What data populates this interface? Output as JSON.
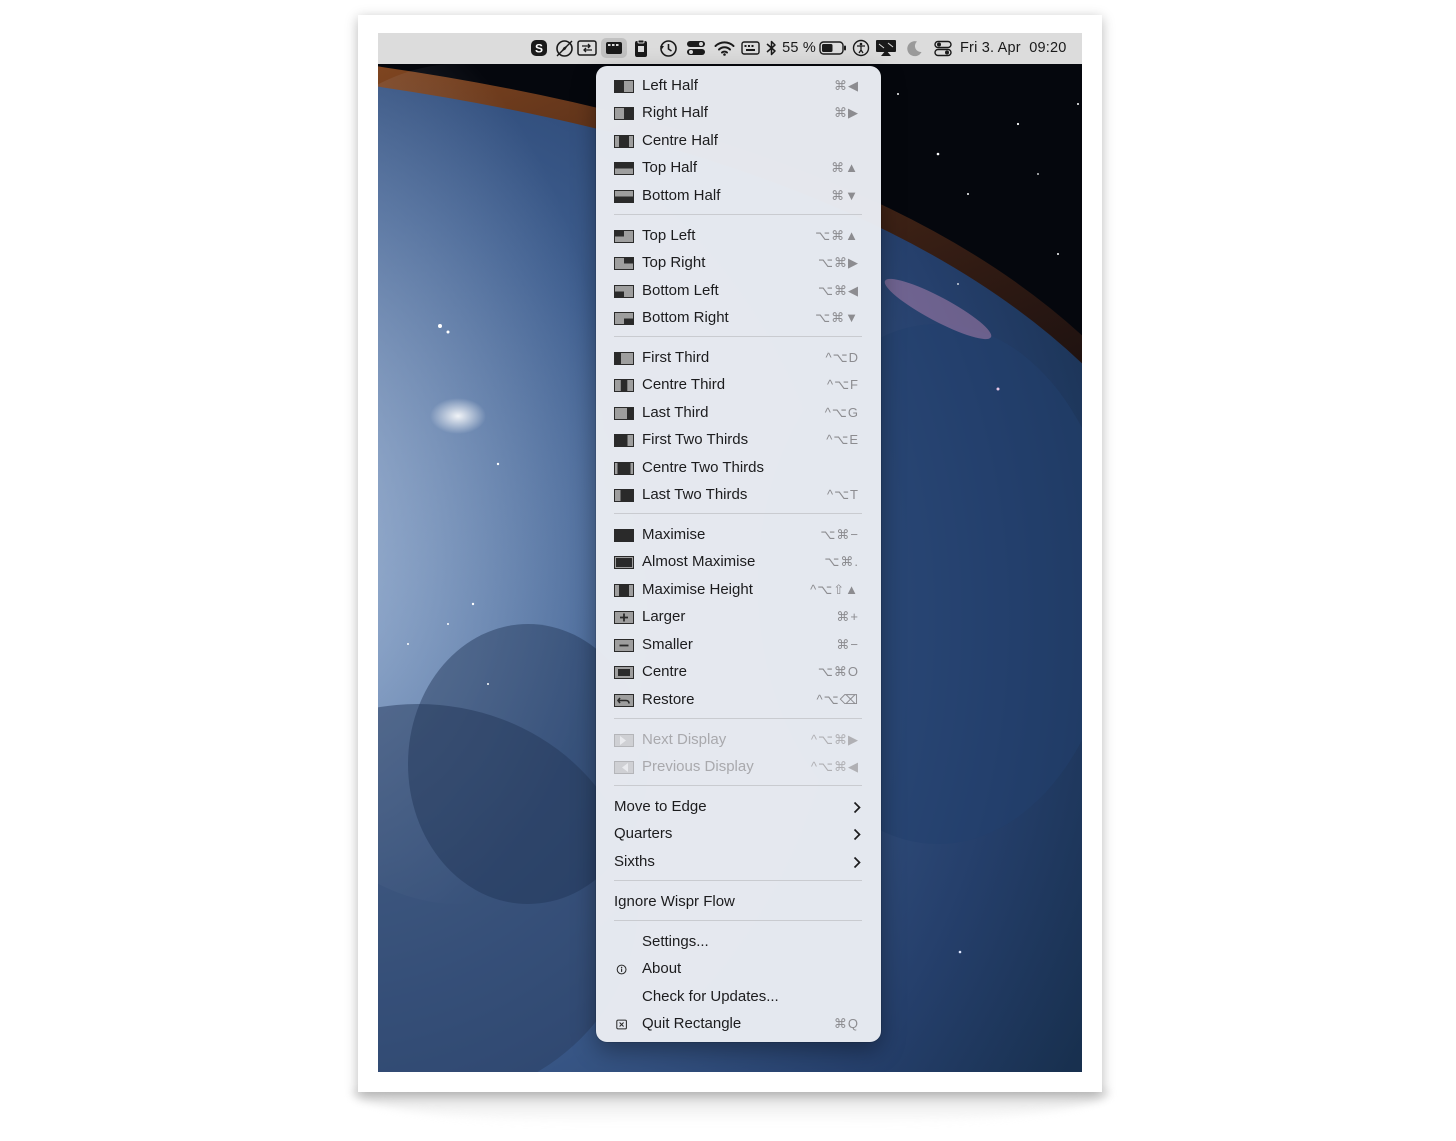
{
  "menubar": {
    "battery_percent": "55 %",
    "datetime": "Fri 3. Apr  09:20",
    "icons": [
      "skype-icon",
      "compass-icon",
      "screen-share-icon",
      "rectangle-app-icon",
      "clipboard-icon",
      "time-machine-icon",
      "control-toggle-icon",
      "wifi-icon",
      "keyboard-icon",
      "bluetooth-icon",
      "battery-icon",
      "accessibility-icon",
      "display-mirroring-icon",
      "moon-icon",
      "control-centre-icon"
    ],
    "battery_level": 0.55
  },
  "menu": {
    "halves": [
      {
        "label": "Left Half",
        "shortcut": "⌘◀",
        "icon": "left-half-icon"
      },
      {
        "label": "Right Half",
        "shortcut": "⌘▶",
        "icon": "right-half-icon"
      },
      {
        "label": "Centre Half",
        "shortcut": "",
        "icon": "centre-half-icon"
      },
      {
        "label": "Top Half",
        "shortcut": "⌘▲",
        "icon": "top-half-icon"
      },
      {
        "label": "Bottom Half",
        "shortcut": "⌘▼",
        "icon": "bottom-half-icon"
      }
    ],
    "corners": [
      {
        "label": "Top Left",
        "shortcut": "⌥⌘▲",
        "icon": "top-left-icon"
      },
      {
        "label": "Top Right",
        "shortcut": "⌥⌘▶",
        "icon": "top-right-icon"
      },
      {
        "label": "Bottom Left",
        "shortcut": "⌥⌘◀",
        "icon": "bottom-left-icon"
      },
      {
        "label": "Bottom Right",
        "shortcut": "⌥⌘▼",
        "icon": "bottom-right-icon"
      }
    ],
    "thirds": [
      {
        "label": "First Third",
        "shortcut": "^⌥D",
        "icon": "first-third-icon"
      },
      {
        "label": "Centre Third",
        "shortcut": "^⌥F",
        "icon": "centre-third-icon"
      },
      {
        "label": "Last Third",
        "shortcut": "^⌥G",
        "icon": "last-third-icon"
      },
      {
        "label": "First Two Thirds",
        "shortcut": "^⌥E",
        "icon": "first-two-thirds-icon"
      },
      {
        "label": "Centre Two Thirds",
        "shortcut": "",
        "icon": "centre-two-thirds-icon"
      },
      {
        "label": "Last Two Thirds",
        "shortcut": "^⌥T",
        "icon": "last-two-thirds-icon"
      }
    ],
    "sizing": [
      {
        "label": "Maximise",
        "shortcut": "⌥⌘−",
        "icon": "maximise-icon"
      },
      {
        "label": "Almost Maximise",
        "shortcut": "⌥⌘.",
        "icon": "almost-maximise-icon"
      },
      {
        "label": "Maximise Height",
        "shortcut": "^⌥⇧▲",
        "icon": "maximise-height-icon"
      },
      {
        "label": "Larger",
        "shortcut": "⌘+",
        "icon": "larger-icon"
      },
      {
        "label": "Smaller",
        "shortcut": "⌘−",
        "icon": "smaller-icon"
      },
      {
        "label": "Centre",
        "shortcut": "⌥⌘O",
        "icon": "centre-icon"
      },
      {
        "label": "Restore",
        "shortcut": "^⌥⌫",
        "icon": "restore-icon"
      }
    ],
    "displays": [
      {
        "label": "Next Display",
        "shortcut": "^⌥⌘▶",
        "icon": "next-display-icon",
        "disabled": true
      },
      {
        "label": "Previous Display",
        "shortcut": "^⌥⌘◀",
        "icon": "previous-display-icon",
        "disabled": true
      }
    ],
    "submenus": [
      {
        "label": "Move to Edge"
      },
      {
        "label": "Quarters"
      },
      {
        "label": "Sixths"
      }
    ],
    "ignore": {
      "label": "Ignore Wispr Flow"
    },
    "app": [
      {
        "label": "Settings...",
        "shortcut": "",
        "icon": ""
      },
      {
        "label": "About",
        "shortcut": "",
        "icon": "info-icon"
      },
      {
        "label": "Check for Updates...",
        "shortcut": "",
        "icon": ""
      },
      {
        "label": "Quit Rectangle",
        "shortcut": "⌘Q",
        "icon": "quit-icon"
      }
    ]
  },
  "colors": {
    "menu_background": "#e8ebf1",
    "menubar_background": "#dcdcdc",
    "icon_dark": "#2a2a2a",
    "icon_light": "#9e9e9e"
  }
}
